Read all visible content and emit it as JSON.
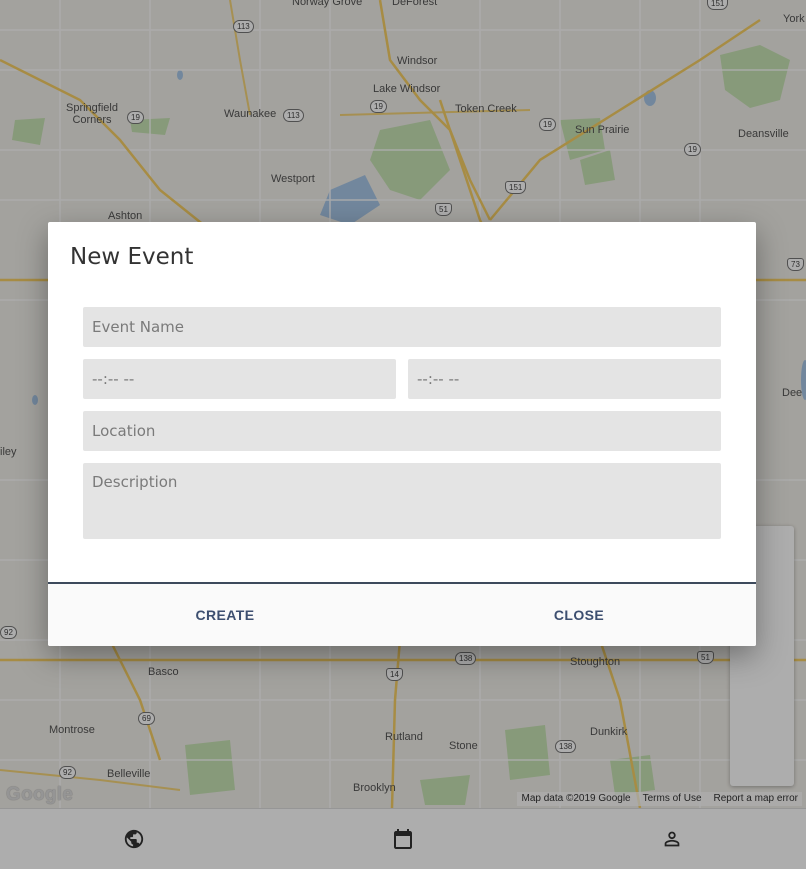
{
  "map": {
    "towns": [
      {
        "name": "Norway Grove",
        "key": "norway-grove"
      },
      {
        "name": "DeForest",
        "key": "deforest"
      },
      {
        "name": "York",
        "key": "york"
      },
      {
        "name": "Windsor",
        "key": "windsor"
      },
      {
        "name": "Lake Windsor",
        "key": "lake-windsor"
      },
      {
        "name": "Springfield Corners",
        "key": "springfield-corners"
      },
      {
        "name": "Waunakee",
        "key": "waunakee"
      },
      {
        "name": "Token Creek",
        "key": "token-creek"
      },
      {
        "name": "Sun Prairie",
        "key": "sun-prairie"
      },
      {
        "name": "Deansville",
        "key": "deansville"
      },
      {
        "name": "Westport",
        "key": "westport"
      },
      {
        "name": "Ashton",
        "key": "ashton"
      },
      {
        "name": "Basco",
        "key": "basco"
      },
      {
        "name": "Stoughton",
        "key": "stoughton"
      },
      {
        "name": "Montrose",
        "key": "montrose"
      },
      {
        "name": "Rutland",
        "key": "rutland"
      },
      {
        "name": "Stone",
        "key": "stone"
      },
      {
        "name": "Dunkirk",
        "key": "dunkirk"
      },
      {
        "name": "Belleville",
        "key": "belleville"
      },
      {
        "name": "Brooklyn",
        "key": "brooklyn"
      },
      {
        "name": "Dee",
        "key": "dee"
      },
      {
        "name": "iley",
        "key": "iley"
      }
    ],
    "shields": [
      "113",
      "151",
      "19",
      "113",
      "19",
      "19",
      "19",
      "151",
      "51",
      "73",
      "92",
      "14",
      "138",
      "51",
      "69",
      "92",
      "138"
    ],
    "logo": "Google",
    "attribution": [
      "Map data ©2019 Google",
      "Terms of Use",
      "Report a map error"
    ]
  },
  "map_tools": [
    {
      "icon": "search-icon",
      "key": "search"
    },
    {
      "icon": "my-location-icon",
      "key": "my-location"
    },
    {
      "icon": "edit-icon",
      "key": "edit"
    },
    {
      "icon": "business-icon",
      "key": "buildings"
    }
  ],
  "bottom_nav": [
    {
      "icon": "globe-icon",
      "key": "map"
    },
    {
      "icon": "calendar-icon",
      "key": "calendar"
    },
    {
      "icon": "person-icon",
      "key": "profile"
    }
  ],
  "dialog": {
    "title": "New Event",
    "fields": {
      "name_placeholder": "Event Name",
      "start_time": "--:-- --",
      "end_time": "--:-- --",
      "location_placeholder": "Location",
      "description_placeholder": "Description"
    },
    "actions": {
      "create": "CREATE",
      "close": "CLOSE"
    }
  },
  "colors": {
    "accent": "#3d4f70",
    "field_bg": "#e4e4e4",
    "overlay": "rgba(0,0,0,0.32)"
  }
}
